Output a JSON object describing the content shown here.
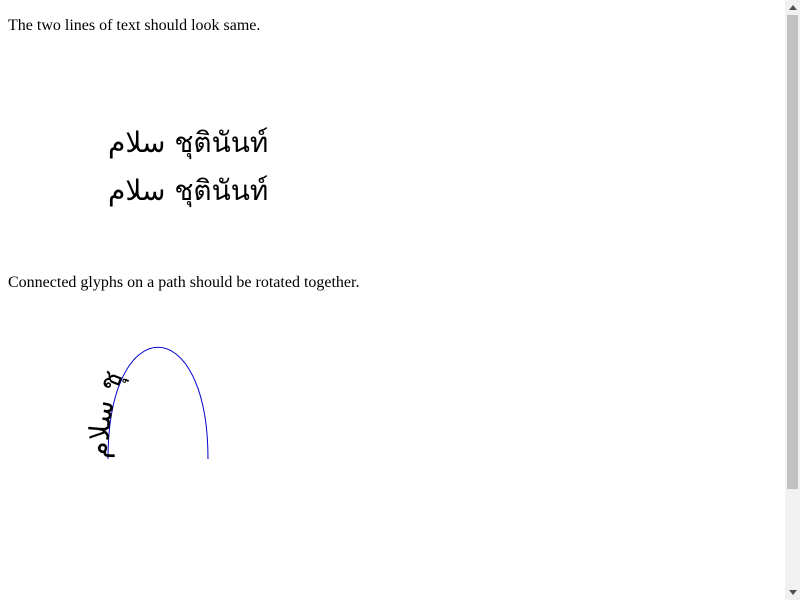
{
  "captions": {
    "same_lines": "The two lines of text should look same.",
    "path_rotation": "Connected glyphs on a path should be rotated together."
  },
  "sample": {
    "line1": "سلام ชุตินันท์",
    "line2": "سلام ชุตินันท์"
  },
  "path_sample": {
    "text": "سلام ชุ"
  },
  "colors": {
    "path_stroke": "#0000cc",
    "text": "#000000",
    "scroll_track": "#f1f1f1",
    "scroll_thumb": "#c1c1c1"
  }
}
